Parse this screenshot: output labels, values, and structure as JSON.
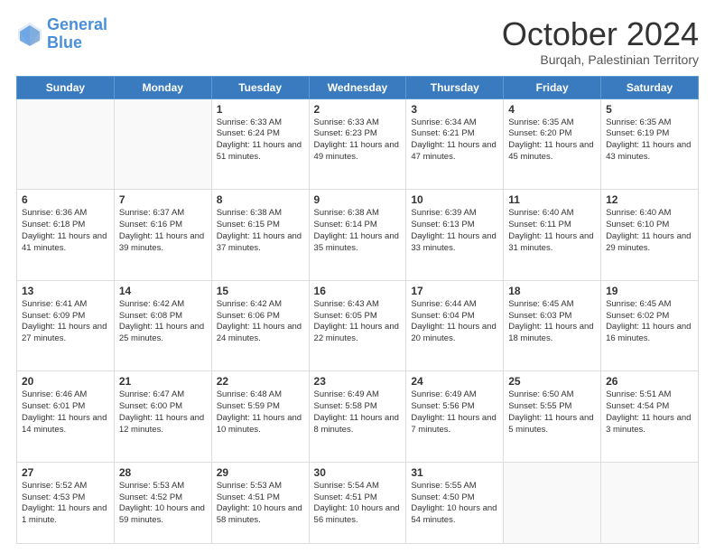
{
  "header": {
    "logo_line1": "General",
    "logo_line2": "Blue",
    "month": "October 2024",
    "location": "Burqah, Palestinian Territory"
  },
  "weekdays": [
    "Sunday",
    "Monday",
    "Tuesday",
    "Wednesday",
    "Thursday",
    "Friday",
    "Saturday"
  ],
  "rows": [
    [
      {
        "day": "",
        "text": ""
      },
      {
        "day": "",
        "text": ""
      },
      {
        "day": "1",
        "text": "Sunrise: 6:33 AM\nSunset: 6:24 PM\nDaylight: 11 hours and 51 minutes."
      },
      {
        "day": "2",
        "text": "Sunrise: 6:33 AM\nSunset: 6:23 PM\nDaylight: 11 hours and 49 minutes."
      },
      {
        "day": "3",
        "text": "Sunrise: 6:34 AM\nSunset: 6:21 PM\nDaylight: 11 hours and 47 minutes."
      },
      {
        "day": "4",
        "text": "Sunrise: 6:35 AM\nSunset: 6:20 PM\nDaylight: 11 hours and 45 minutes."
      },
      {
        "day": "5",
        "text": "Sunrise: 6:35 AM\nSunset: 6:19 PM\nDaylight: 11 hours and 43 minutes."
      }
    ],
    [
      {
        "day": "6",
        "text": "Sunrise: 6:36 AM\nSunset: 6:18 PM\nDaylight: 11 hours and 41 minutes."
      },
      {
        "day": "7",
        "text": "Sunrise: 6:37 AM\nSunset: 6:16 PM\nDaylight: 11 hours and 39 minutes."
      },
      {
        "day": "8",
        "text": "Sunrise: 6:38 AM\nSunset: 6:15 PM\nDaylight: 11 hours and 37 minutes."
      },
      {
        "day": "9",
        "text": "Sunrise: 6:38 AM\nSunset: 6:14 PM\nDaylight: 11 hours and 35 minutes."
      },
      {
        "day": "10",
        "text": "Sunrise: 6:39 AM\nSunset: 6:13 PM\nDaylight: 11 hours and 33 minutes."
      },
      {
        "day": "11",
        "text": "Sunrise: 6:40 AM\nSunset: 6:11 PM\nDaylight: 11 hours and 31 minutes."
      },
      {
        "day": "12",
        "text": "Sunrise: 6:40 AM\nSunset: 6:10 PM\nDaylight: 11 hours and 29 minutes."
      }
    ],
    [
      {
        "day": "13",
        "text": "Sunrise: 6:41 AM\nSunset: 6:09 PM\nDaylight: 11 hours and 27 minutes."
      },
      {
        "day": "14",
        "text": "Sunrise: 6:42 AM\nSunset: 6:08 PM\nDaylight: 11 hours and 25 minutes."
      },
      {
        "day": "15",
        "text": "Sunrise: 6:42 AM\nSunset: 6:06 PM\nDaylight: 11 hours and 24 minutes."
      },
      {
        "day": "16",
        "text": "Sunrise: 6:43 AM\nSunset: 6:05 PM\nDaylight: 11 hours and 22 minutes."
      },
      {
        "day": "17",
        "text": "Sunrise: 6:44 AM\nSunset: 6:04 PM\nDaylight: 11 hours and 20 minutes."
      },
      {
        "day": "18",
        "text": "Sunrise: 6:45 AM\nSunset: 6:03 PM\nDaylight: 11 hours and 18 minutes."
      },
      {
        "day": "19",
        "text": "Sunrise: 6:45 AM\nSunset: 6:02 PM\nDaylight: 11 hours and 16 minutes."
      }
    ],
    [
      {
        "day": "20",
        "text": "Sunrise: 6:46 AM\nSunset: 6:01 PM\nDaylight: 11 hours and 14 minutes."
      },
      {
        "day": "21",
        "text": "Sunrise: 6:47 AM\nSunset: 6:00 PM\nDaylight: 11 hours and 12 minutes."
      },
      {
        "day": "22",
        "text": "Sunrise: 6:48 AM\nSunset: 5:59 PM\nDaylight: 11 hours and 10 minutes."
      },
      {
        "day": "23",
        "text": "Sunrise: 6:49 AM\nSunset: 5:58 PM\nDaylight: 11 hours and 8 minutes."
      },
      {
        "day": "24",
        "text": "Sunrise: 6:49 AM\nSunset: 5:56 PM\nDaylight: 11 hours and 7 minutes."
      },
      {
        "day": "25",
        "text": "Sunrise: 6:50 AM\nSunset: 5:55 PM\nDaylight: 11 hours and 5 minutes."
      },
      {
        "day": "26",
        "text": "Sunrise: 5:51 AM\nSunset: 4:54 PM\nDaylight: 11 hours and 3 minutes."
      }
    ],
    [
      {
        "day": "27",
        "text": "Sunrise: 5:52 AM\nSunset: 4:53 PM\nDaylight: 11 hours and 1 minute."
      },
      {
        "day": "28",
        "text": "Sunrise: 5:53 AM\nSunset: 4:52 PM\nDaylight: 10 hours and 59 minutes."
      },
      {
        "day": "29",
        "text": "Sunrise: 5:53 AM\nSunset: 4:51 PM\nDaylight: 10 hours and 58 minutes."
      },
      {
        "day": "30",
        "text": "Sunrise: 5:54 AM\nSunset: 4:51 PM\nDaylight: 10 hours and 56 minutes."
      },
      {
        "day": "31",
        "text": "Sunrise: 5:55 AM\nSunset: 4:50 PM\nDaylight: 10 hours and 54 minutes."
      },
      {
        "day": "",
        "text": ""
      },
      {
        "day": "",
        "text": ""
      }
    ]
  ]
}
